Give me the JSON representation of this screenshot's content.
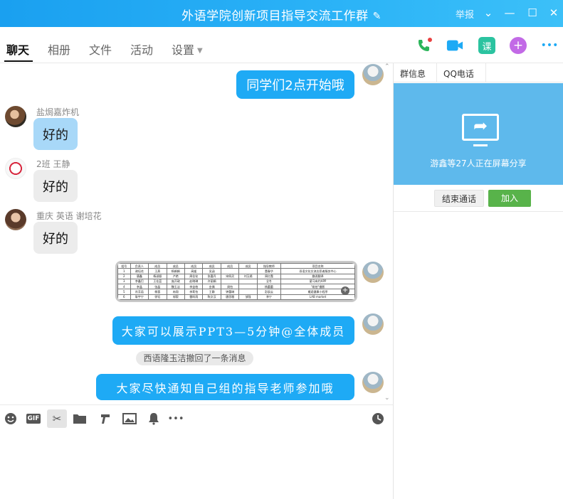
{
  "window": {
    "title": "外语学院创新项目指导交流工作群",
    "report_label": "举报"
  },
  "tabs": [
    {
      "label": "聊天"
    },
    {
      "label": "相册"
    },
    {
      "label": "文件"
    },
    {
      "label": "活动"
    },
    {
      "label": "设置"
    }
  ],
  "actions": {
    "course_label": "课",
    "add_label": "+",
    "more_label": "•••"
  },
  "messages": [
    {
      "sender": "",
      "text": "同学们2点开始哦"
    },
    {
      "sender": "盐焗嘉炸机",
      "text": "好的"
    },
    {
      "sender": "2班 王静",
      "text": "好的"
    },
    {
      "sender": "重庆 英语 谢培花",
      "text": "好的"
    },
    {
      "sender": "",
      "text": "大家可以展示PPT3—5分钟@全体成员"
    },
    {
      "sender": "",
      "text": "大家尽快通知自己组的指导老师参加哦"
    }
  ],
  "image_table": {
    "headers": [
      "组号",
      "负责人",
      "成员",
      "成员",
      "成员",
      "成员",
      "成员",
      "成员",
      "指导教师",
      "项目名称"
    ],
    "rows": [
      [
        "1",
        "谢培花",
        "王燕",
        "杨娟娟",
        "高媛",
        "吴涵",
        "",
        "",
        "董春华",
        "双语文化交流志愿者服务中心"
      ],
      [
        "2",
        "唐鑫",
        "杨淑颖",
        "卢艳",
        "周佳钦",
        "张嘉丹",
        "宋佩灵",
        "刘玉嫣",
        "周红霞",
        "趣说翻译"
      ],
      [
        "3",
        "李鑫巴",
        "王佳蓝",
        "庞开政",
        "赵晓琳",
        "许丽娟",
        "",
        "",
        "全冬",
        "星马有约APP"
      ],
      [
        "4",
        "李晶",
        "张晶",
        "魏玉洁",
        "李益柏",
        "金偶",
        "周怡",
        "",
        "杨蕾蕾",
        "\"易拍\"摄影"
      ],
      [
        "5",
        "肖芳茹",
        "杨蓉",
        "冉翔",
        "李莉怡",
        "王静",
        "钟蕾琳",
        "",
        "彭辰云",
        "邂逅健康小程序"
      ],
      [
        "6",
        "耿宇宁",
        "徐钰",
        "邬毅",
        "雷昕雨",
        "陈文汉",
        "唐思雅",
        "邹强",
        "李宁",
        "LAB market"
      ]
    ]
  },
  "system_notice": "西语隆玉洁撤回了一条消息",
  "toolbar": {
    "gif_label": "GIF"
  },
  "side_panel": {
    "tabs": [
      "群信息",
      "QQ电话"
    ],
    "share_message": "游鑫等27人正在屏幕分享",
    "end_call_label": "结束通话",
    "join_label": "加入"
  },
  "colors": {
    "titlebar": "#1aa0f0",
    "my_bubble": "#1eaaf5",
    "other_bubble": "#ececec",
    "share_panel": "#5eb9ec",
    "join_button": "#58b34a"
  }
}
